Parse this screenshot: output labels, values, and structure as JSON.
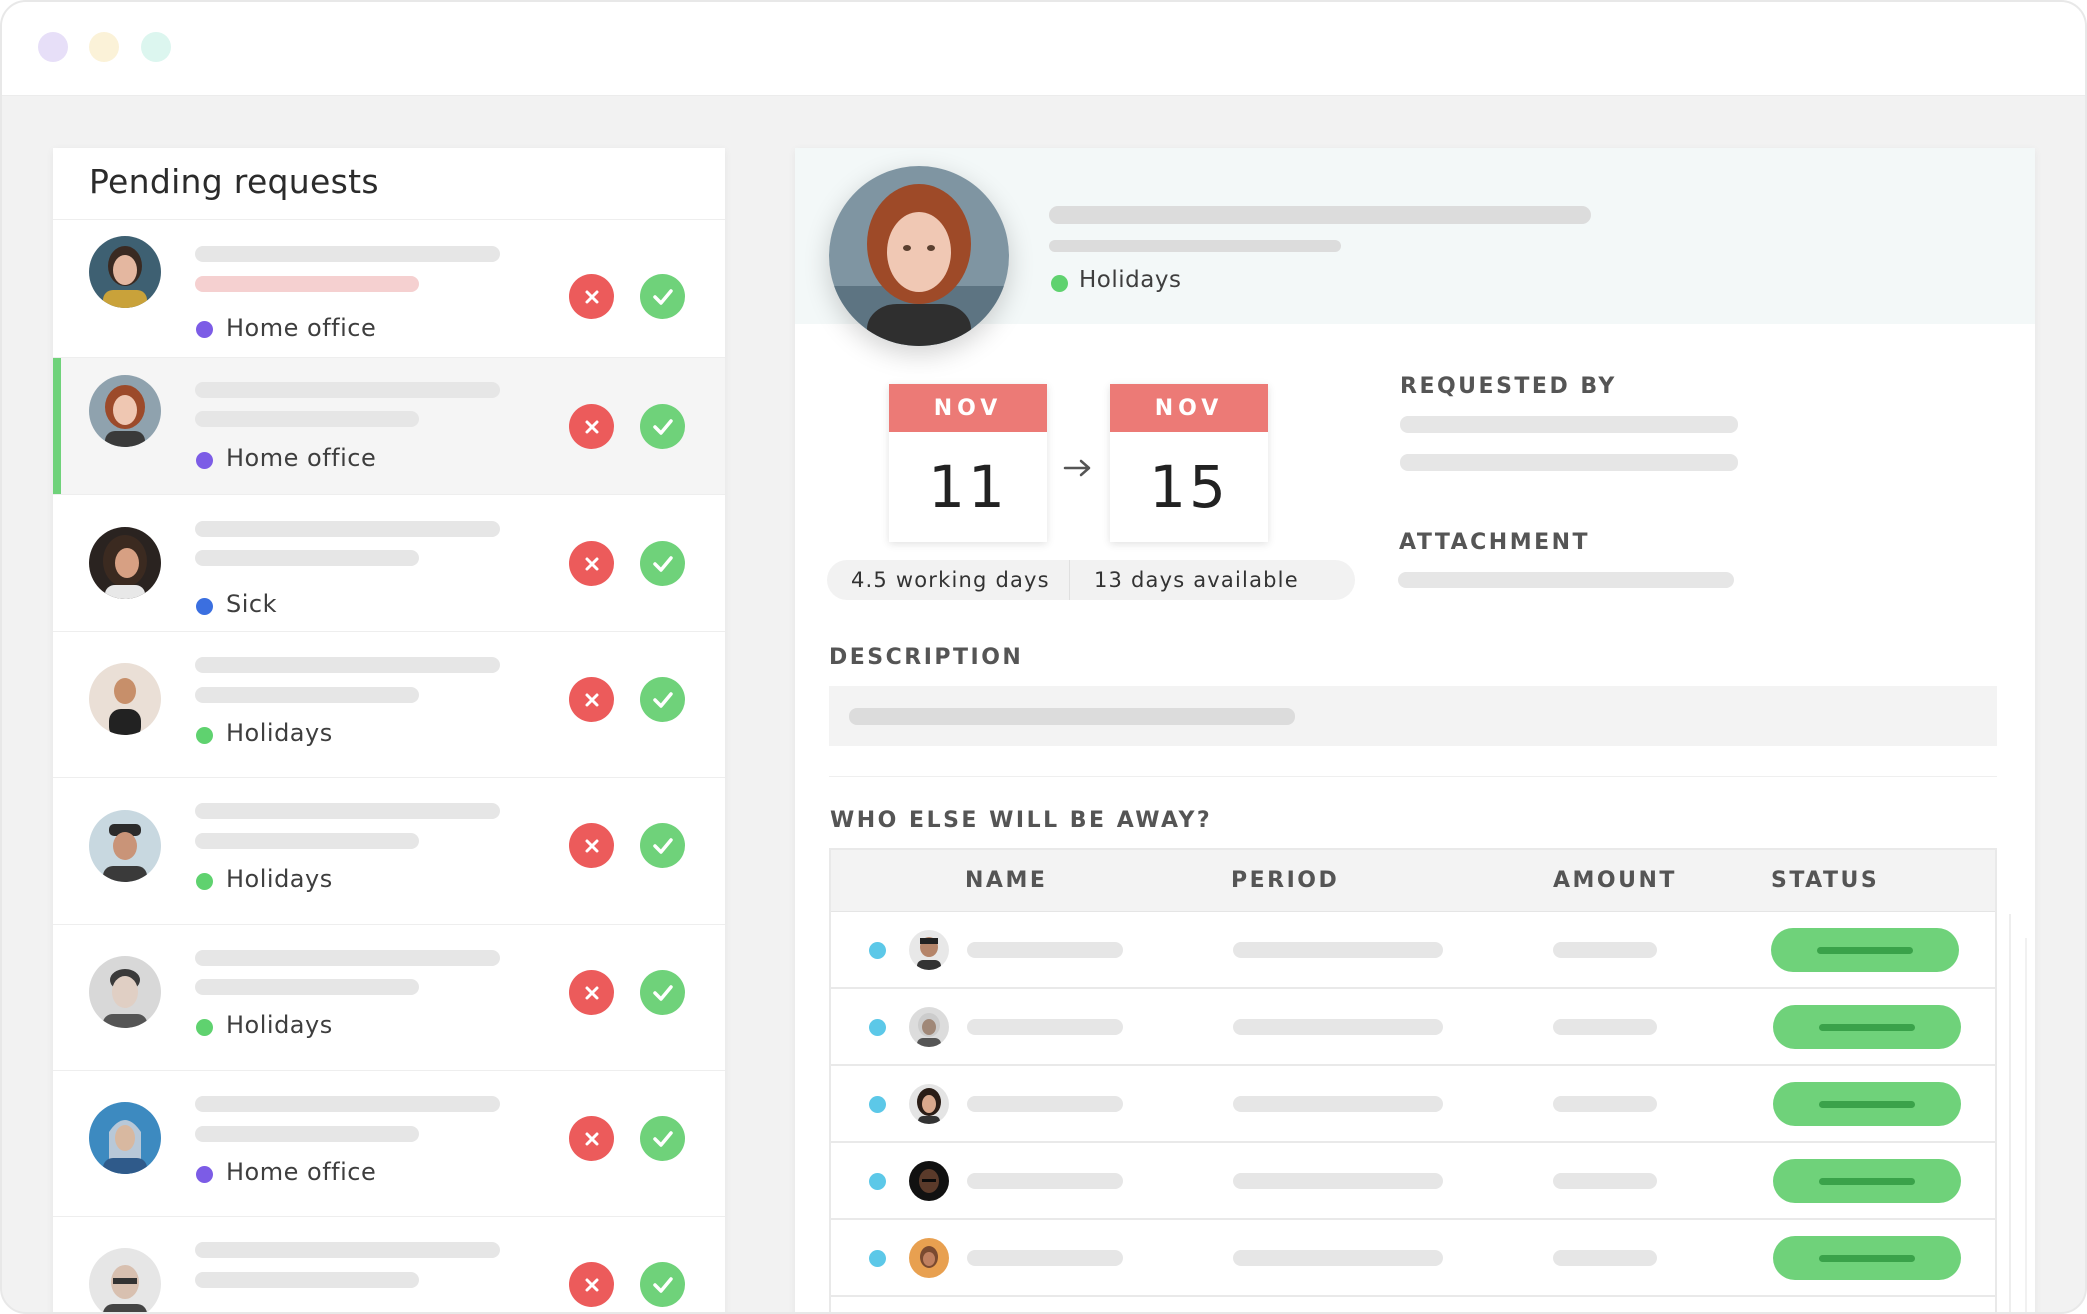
{
  "window": {
    "dot_colors": [
      "#e7dff8",
      "#fbf2d8",
      "#dcf6ef"
    ]
  },
  "pending": {
    "title": "Pending requests",
    "requests": [
      {
        "type": "Home office",
        "type_color": "#7c5ce6"
      },
      {
        "type": "Home office",
        "type_color": "#7c5ce6",
        "selected": true
      },
      {
        "type": "Sick",
        "type_color": "#3b6fe0"
      },
      {
        "type": "Holidays",
        "type_color": "#5fd26f"
      },
      {
        "type": "Holidays",
        "type_color": "#5fd26f"
      },
      {
        "type": "Holidays",
        "type_color": "#5fd26f"
      },
      {
        "type": "Home office",
        "type_color": "#7c5ce6"
      },
      {
        "type": "",
        "type_color": "#7c5ce6"
      }
    ]
  },
  "detail": {
    "type": "Holidays",
    "type_color": "#5fd26f",
    "start": {
      "month": "NOV",
      "day": "11"
    },
    "end": {
      "month": "NOV",
      "day": "15"
    },
    "arrow": "→",
    "working_days": "4.5 working days",
    "days_available": "13 days available",
    "requested_by_label": "REQUESTED BY",
    "attachment_label": "ATTACHMENT",
    "description_label": "DESCRIPTION",
    "away_label": "WHO ELSE WILL BE AWAY?",
    "table_headers": {
      "name": "NAME",
      "period": "PERIOD",
      "amount": "AMOUNT",
      "status": "STATUS"
    }
  },
  "colors": {
    "reject": "#ec5b5b",
    "approve": "#6fd27a",
    "accent": "#6fd27a",
    "calendar_header": "#ec7a76"
  },
  "icons": [
    "close-icon",
    "check-icon",
    "arrow-right-icon"
  ]
}
